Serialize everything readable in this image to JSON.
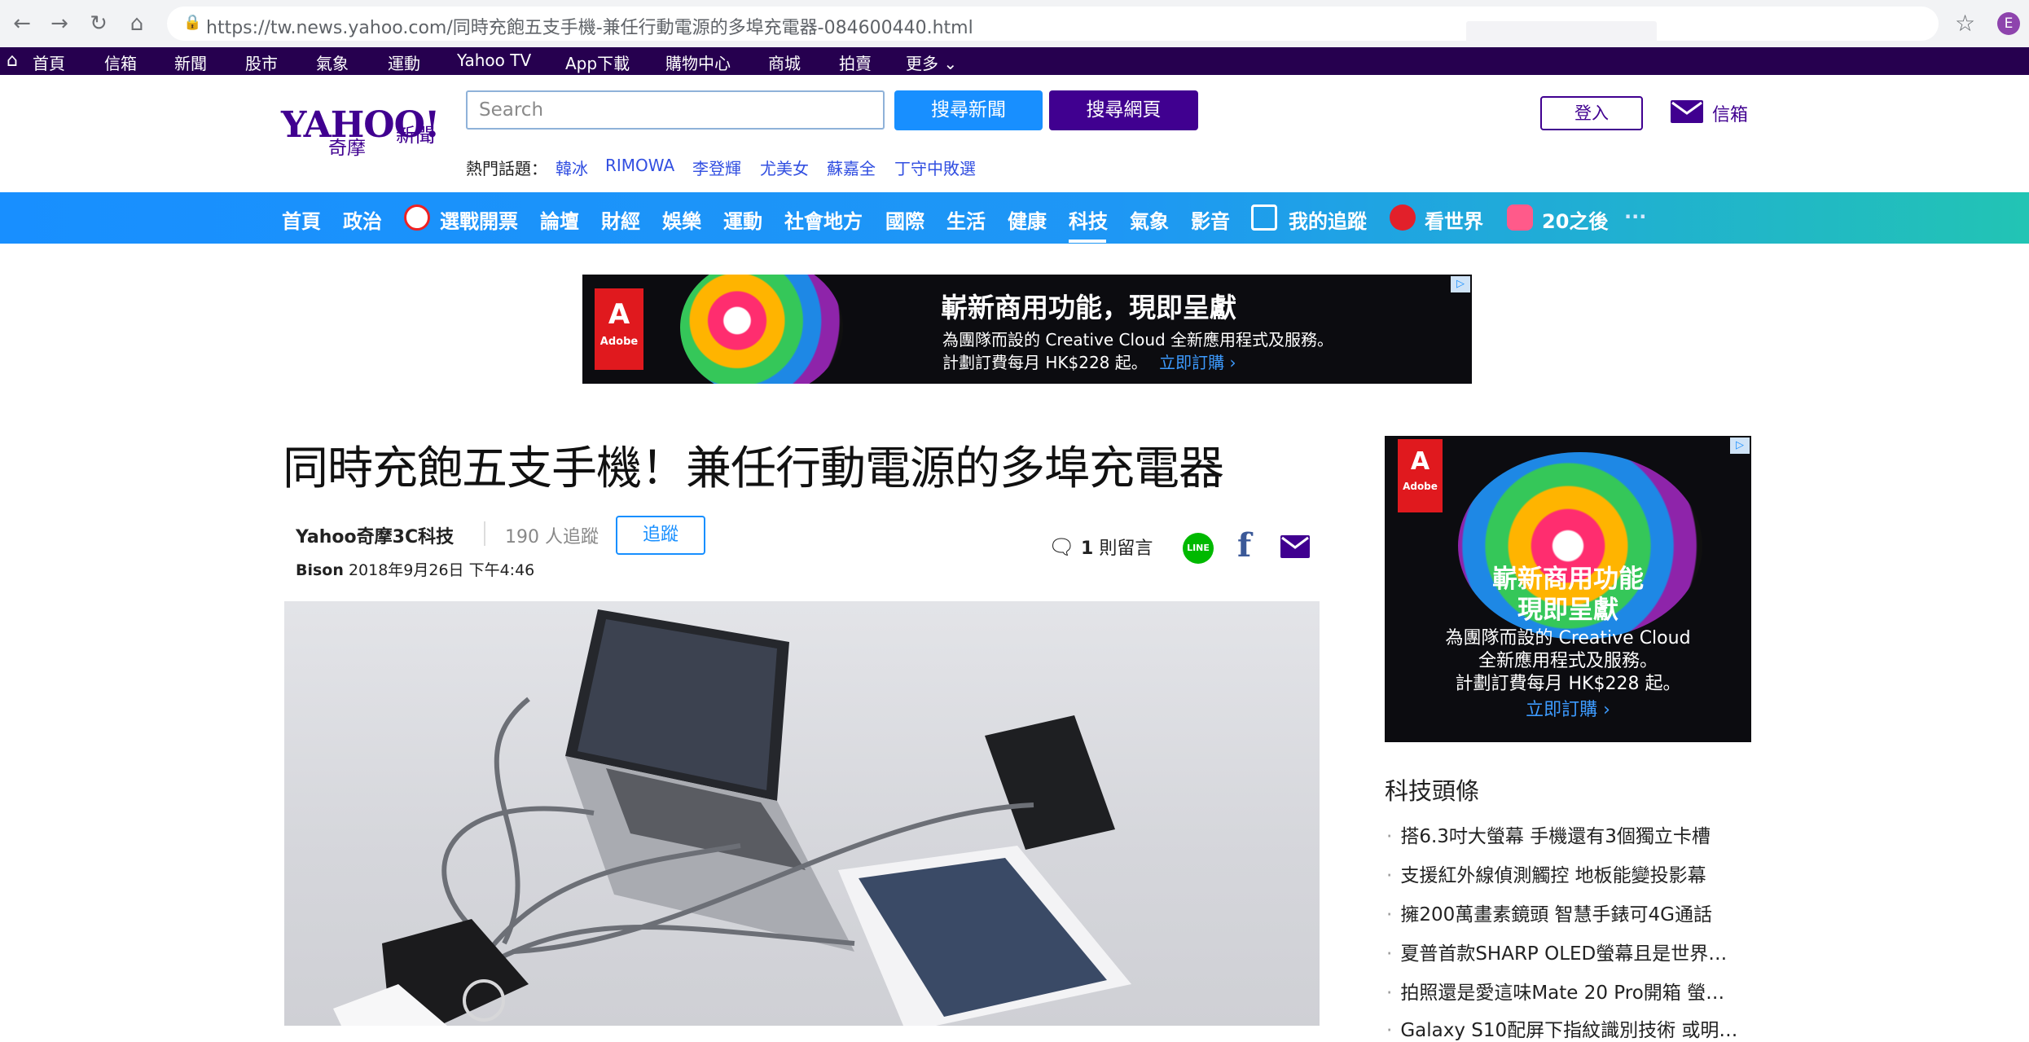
{
  "browser": {
    "url": "https://tw.news.yahoo.com/同時充飽五支手機-兼任行動電源的多埠充電器-084600440.html",
    "profile_initial": "E"
  },
  "topbar": {
    "items": [
      "首頁",
      "信箱",
      "新聞",
      "股市",
      "氣象",
      "運動",
      "Yahoo TV",
      "App下載",
      "購物中心",
      "商城",
      "拍賣",
      "更多"
    ]
  },
  "header": {
    "logo": "YAHOO!",
    "logo_sub": "奇摩",
    "logo_section": "新聞",
    "search_placeholder": "Search",
    "search_news_label": "搜尋新聞",
    "search_web_label": "搜尋網頁",
    "hot_label": "熱門話題：",
    "hot_topics": [
      "韓冰",
      "RIMOWA",
      "李登輝",
      "尤美女",
      "蘇嘉全",
      "丁守中敗選"
    ],
    "signin_label": "登入",
    "mail_label": "信箱"
  },
  "categories": [
    "首頁",
    "政治",
    "選戰開票",
    "論壇",
    "財經",
    "娛樂",
    "運動",
    "社會地方",
    "國際",
    "生活",
    "健康",
    "科技",
    "氣象",
    "影音",
    "我的追蹤",
    "看世界",
    "20之後",
    "···"
  ],
  "active_category": "科技",
  "banner_ad": {
    "brand": "Adobe",
    "headline": "嶄新商用功能，現即呈獻",
    "line1": "為團隊而設的 Creative Cloud 全新應用程式及服務。",
    "line2": "計劃訂費每月 HK$228 起。",
    "cta": "立即訂購 ›"
  },
  "article": {
    "title": "同時充飽五支手機！兼任行動電源的多埠充電器",
    "source": "Yahoo奇摩3C科技",
    "followers": "190 人追蹤",
    "follow_label": "追蹤",
    "author": "Bison",
    "datetime": "2018年9月26日 下午4:46",
    "comments_count": "1",
    "comments_label": "則留言"
  },
  "side_ad": {
    "brand": "Adobe",
    "headline1": "嶄新商用功能",
    "headline2": "現即呈獻",
    "line1": "為團隊而設的 Creative Cloud",
    "line2": "全新應用程式及服務。",
    "line3": "計劃訂費每月 HK$228 起。",
    "cta": "立即訂購 ›"
  },
  "sidebar": {
    "title": "科技頭條",
    "items": [
      "搭6.3吋大螢幕 手機還有3個獨立卡槽",
      "支援紅外線偵測觸控 地板能變投影幕",
      "擁200萬畫素鏡頭 智慧手錶可4G通話",
      "夏普首款SHARP OLED螢幕且是世界…",
      "拍照還是愛這味Mate 20 Pro開箱 螢…",
      "Galaxy S10配屏下指紋識別技術 或明…"
    ]
  },
  "colors": {
    "yahoo_purple": "#400090",
    "yahoo_blue": "#188fff",
    "topbar_bg": "#26004f"
  }
}
